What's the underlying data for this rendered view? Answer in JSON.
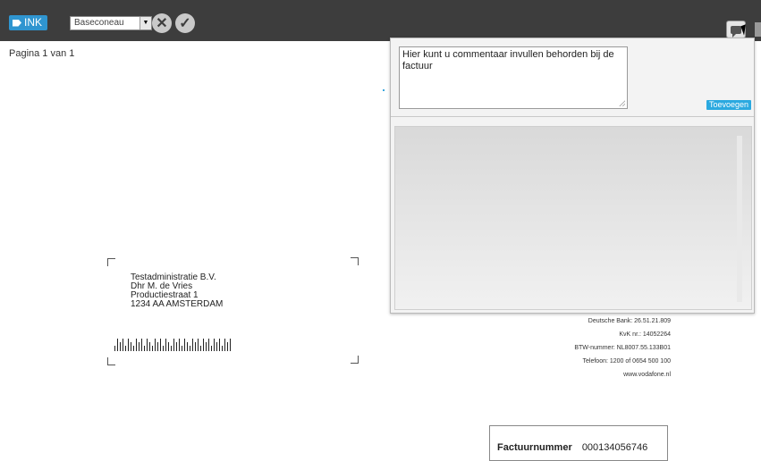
{
  "toolbar": {
    "ink_label": "INK",
    "dropdown_value": "Baseconeau",
    "cancel_symbol": "✕",
    "confirm_symbol": "✓",
    "comment_icon": "comment-bubble-icon"
  },
  "page_info": "Pagina 1 van 1",
  "document": {
    "address": [
      "Testadministratie B.V.",
      "Dhr M. de Vries",
      "Productiestraat 1",
      "1234 AA AMSTERDAM"
    ],
    "company_info": [
      "Deutsche Bank: 26.51.21.809",
      "KvK nr.: 14052264",
      "BTW-nummer: NL8007.55.133B01",
      "Telefoon: 1200 of 0654 500 100",
      "www.vodafone.nl"
    ],
    "factuur_label": "Factuurnummer",
    "factuur_value": "000134056746"
  },
  "comment_panel": {
    "placeholder": "Hier kunt u commentaar invullen behorden bij de factuur",
    "add_label": "Toevoegen"
  },
  "colors": {
    "toolbar_bg": "#3d3d3d",
    "accent": "#2f95d0"
  }
}
